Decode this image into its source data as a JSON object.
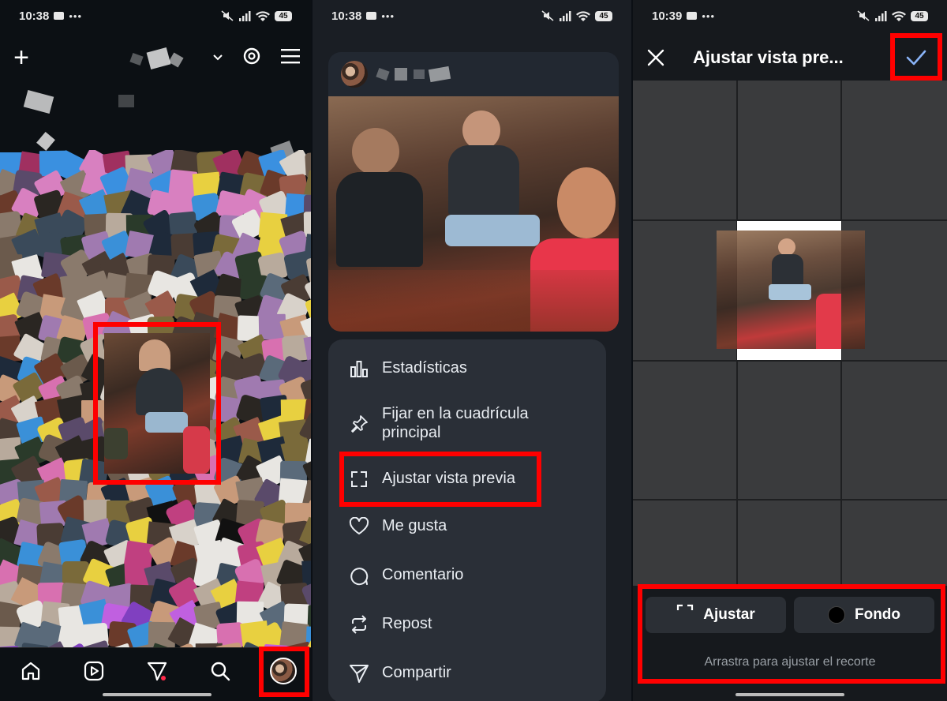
{
  "panel1": {
    "status": {
      "time": "10:38",
      "battery": "45"
    }
  },
  "panel2": {
    "status": {
      "time": "10:38",
      "battery": "45"
    },
    "menu": [
      {
        "label": "Estadísticas",
        "icon": "bar-chart-icon"
      },
      {
        "label": "Fijar en la cuadrícula principal",
        "icon": "pin-icon"
      },
      {
        "label": "Ajustar vista previa",
        "icon": "expand-icon"
      },
      {
        "label": "Me gusta",
        "icon": "heart-icon"
      },
      {
        "label": "Comentario",
        "icon": "comment-icon"
      },
      {
        "label": "Repost",
        "icon": "repost-icon"
      },
      {
        "label": "Compartir",
        "icon": "share-icon"
      }
    ]
  },
  "panel3": {
    "status": {
      "time": "10:39",
      "battery": "45"
    },
    "title": "Ajustar vista pre...",
    "buttons": {
      "ajustar": "Ajustar",
      "fondo": "Fondo"
    },
    "hint": "Arrastra para ajustar el recorte"
  },
  "colors": {
    "highlight": "#ff0000",
    "accent": "#8ab4f8"
  }
}
